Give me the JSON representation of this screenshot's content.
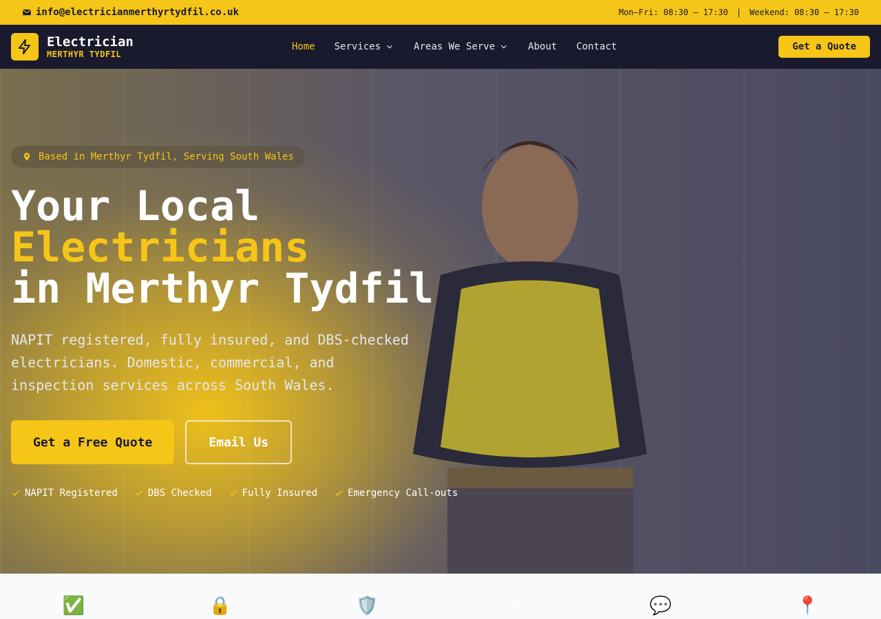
{
  "topbar": {
    "email": "info@electricianmerthyrtydfil.co.uk",
    "hours_weekday": "Mon–Fri: 08:30 – 17:30",
    "separator": "|",
    "hours_weekend": "Weekend: 08:30 – 17:30"
  },
  "brand": {
    "name": "Electrician",
    "sub": "MERTHYR TYDFIL"
  },
  "nav": {
    "items": [
      {
        "label": "Home",
        "active": true
      },
      {
        "label": "Services",
        "dropdown": true
      },
      {
        "label": "Areas We Serve",
        "dropdown": true
      },
      {
        "label": "About"
      },
      {
        "label": "Contact"
      }
    ],
    "cta": "Get a Quote"
  },
  "hero": {
    "pill": "Based in Merthyr Tydfil, Serving South Wales",
    "title_line1": "Your Local",
    "title_accent": "Electricians",
    "title_line3": "in Merthyr Tydfil",
    "lead": "NAPIT registered, fully insured, and DBS-checked electricians. Domestic, commercial, and inspection services across South Wales.",
    "cta_primary": "Get a Free Quote",
    "cta_secondary": "Email Us",
    "badges": [
      "NAPIT Registered",
      "DBS Checked",
      "Fully Insured",
      "Emergency Call-outs"
    ]
  },
  "features": {
    "icons": [
      "✅",
      "🔒",
      "🛡️",
      "⚡",
      "💬",
      "📍"
    ]
  },
  "colors": {
    "accent": "#f5c518",
    "nav_bg": "#1a1a2e"
  }
}
